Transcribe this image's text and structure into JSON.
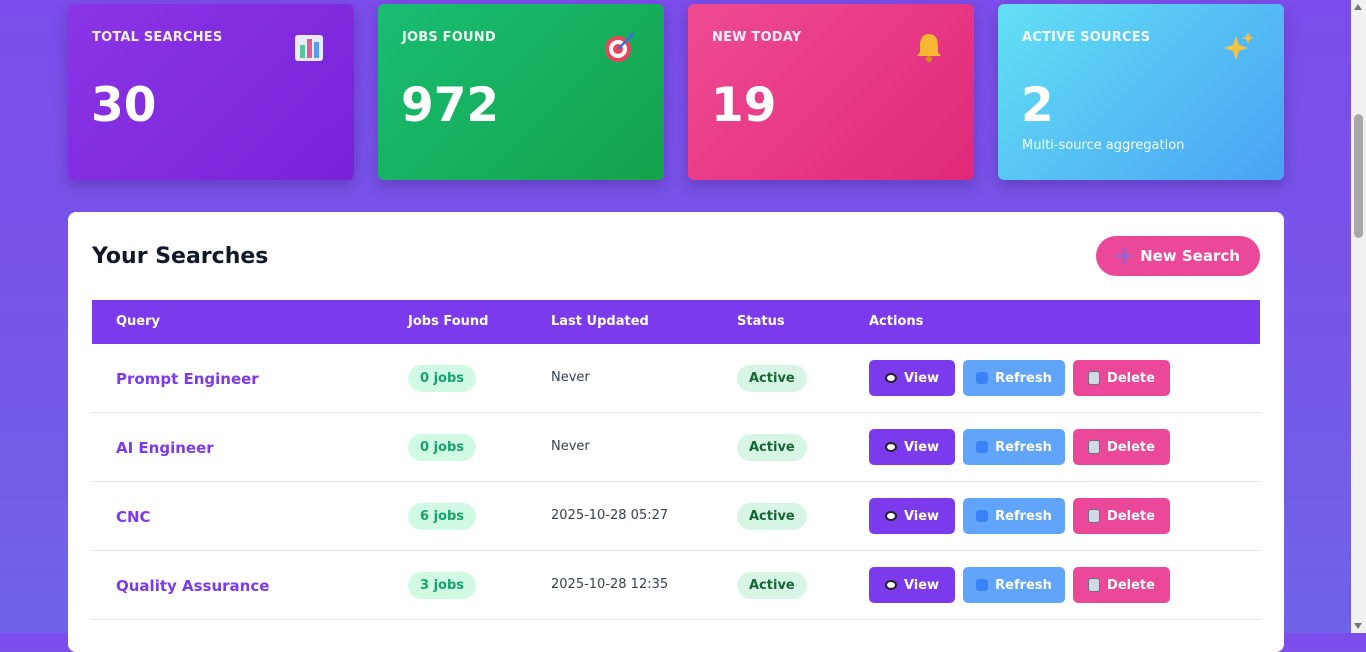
{
  "stats": [
    {
      "label": "TOTAL SEARCHES",
      "value": "30",
      "icon": "bar-chart-icon"
    },
    {
      "label": "JOBS FOUND",
      "value": "972",
      "icon": "target-icon"
    },
    {
      "label": "NEW TODAY",
      "value": "19",
      "icon": "bell-icon"
    },
    {
      "label": "ACTIVE SOURCES",
      "value": "2",
      "icon": "sparkles-icon",
      "sub": "Multi-source aggregation"
    }
  ],
  "panel": {
    "title": "Your Searches",
    "new_button": "New Search",
    "columns": [
      "Query",
      "Jobs Found",
      "Last Updated",
      "Status",
      "Actions"
    ],
    "rows": [
      {
        "query": "Prompt Engineer",
        "jobs": "0 jobs",
        "updated": "Never",
        "status": "Active"
      },
      {
        "query": "AI Engineer",
        "jobs": "0 jobs",
        "updated": "Never",
        "status": "Active"
      },
      {
        "query": "CNC",
        "jobs": "6 jobs",
        "updated": "2025-10-28 05:27",
        "status": "Active"
      },
      {
        "query": "Quality Assurance",
        "jobs": "3 jobs",
        "updated": "2025-10-28 12:35",
        "status": "Active"
      }
    ],
    "actions": {
      "view": "View",
      "refresh": "Refresh",
      "delete": "Delete"
    }
  }
}
